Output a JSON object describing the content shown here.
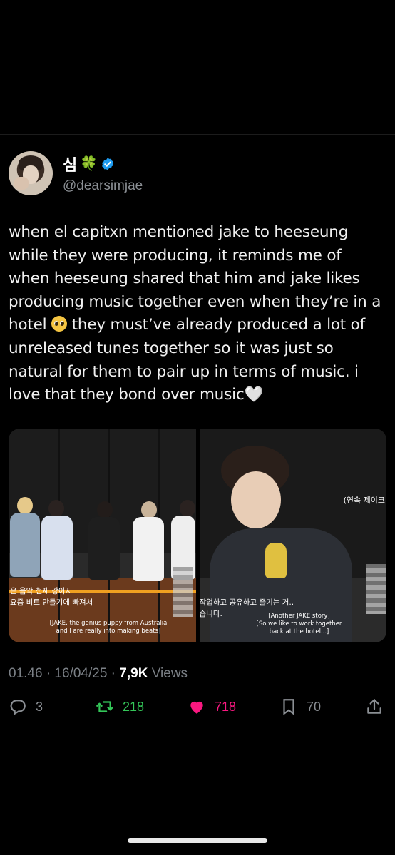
{
  "author": {
    "display_name": "심",
    "emoji": "🍀",
    "handle": "@dearsimjae",
    "verified": true
  },
  "tweet": {
    "lines": [
      "when el capitxn mentioned jake to heeseung",
      "while they were producing, it reminds me of",
      "when heeseung shared that him and jake likes",
      "producing music together even when they’re in a",
      "hotel",
      " they must’ve already produced a lot of",
      "unreleased tunes together so it was just so",
      "natural for them to pair up in terms of music. i",
      "love that they bond over music",
      "🤍"
    ]
  },
  "media": {
    "left": {
      "korean_line1": "은 음악 천재 강아지",
      "korean_line2": "요즘 비트 만들기에 빠져서",
      "english_line1": "[JAKE, the genius puppy from Australia",
      "english_line2": "and I are really into making beats]"
    },
    "right": {
      "tag": "(연속 제이크 ",
      "korean_line1": "작업하고 공유하고 즐기는 거..",
      "korean_line2": "습니다.",
      "english_line1": "[Another JAKE story]",
      "english_line2": "[So we like to work together",
      "english_line3": "back at the hotel...]"
    }
  },
  "meta": {
    "time_date": "01.46 · 16/04/25 · ",
    "views_count": "7,9K",
    "views_label": " Views"
  },
  "actions": {
    "replies": "3",
    "retweets": "218",
    "likes": "718",
    "bookmarks": "70"
  },
  "colors": {
    "background": "#000000",
    "verified": "#1d9bf0",
    "retweet": "#34c759",
    "like": "#f91880"
  }
}
